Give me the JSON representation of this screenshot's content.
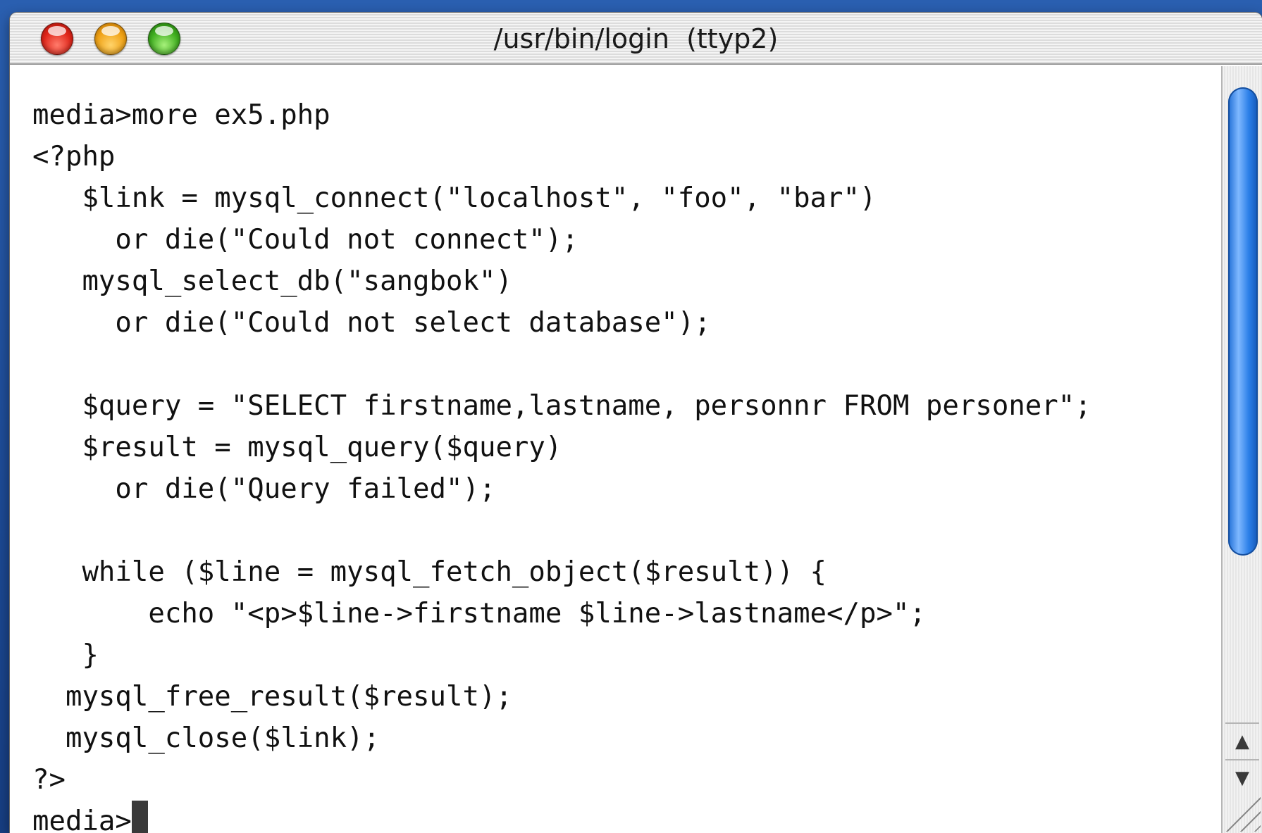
{
  "window": {
    "title": "/usr/bin/login  (ttyp2)"
  },
  "terminal": {
    "lines": [
      "media>more ex5.php",
      "<?php",
      "   $link = mysql_connect(\"localhost\", \"foo\", \"bar\")",
      "     or die(\"Could not connect\");",
      "   mysql_select_db(\"sangbok\")",
      "     or die(\"Could not select database\");",
      "",
      "   $query = \"SELECT firstname,lastname, personnr FROM personer\";",
      "   $result = mysql_query($query)",
      "     or die(\"Query failed\");",
      "",
      "   while ($line = mysql_fetch_object($result)) {",
      "       echo \"<p>$line->firstname $line->lastname</p>\";",
      "   }",
      "  mysql_free_result($result);",
      "  mysql_close($link);",
      "?>"
    ],
    "prompt": "media>"
  },
  "icons": {
    "close": "close-button-icon",
    "minimize": "minimize-button-icon",
    "zoom": "zoom-button-icon",
    "scroll_up": "arrow-up-icon",
    "scroll_down": "arrow-down-icon",
    "resize": "resize-grip-icon"
  },
  "colors": {
    "close": "#e0261a",
    "minimize": "#f0a215",
    "zoom": "#3fae1f",
    "scroll_thumb": "#2b7fe8"
  }
}
